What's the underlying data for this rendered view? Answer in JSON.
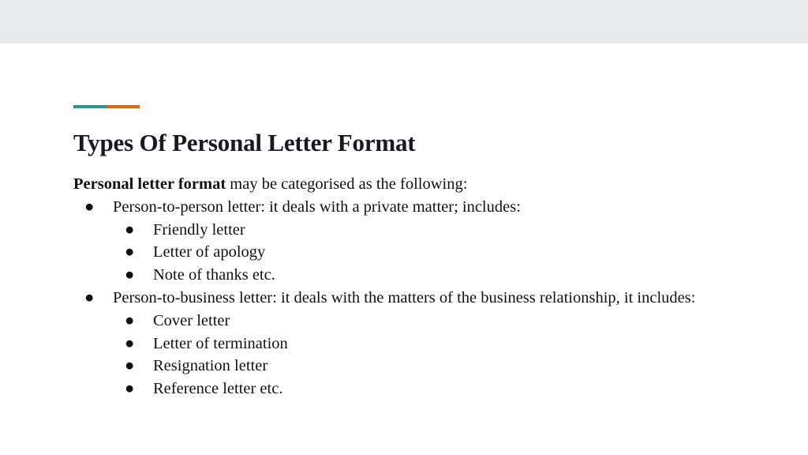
{
  "slide": {
    "title": "Types Of Personal Letter Format",
    "accent_colors": [
      "#26998a",
      "#e8600f"
    ],
    "intro_bold": "Personal letter format",
    "intro_rest": " may be categorised as the following:",
    "bullet_glyph": "●",
    "items": [
      {
        "text": "Person-to-person letter: it deals with a private matter; includes:",
        "subitems": [
          "Friendly letter",
          "Letter of apology",
          "Note of thanks etc."
        ]
      },
      {
        "text": "Person-to-business letter: it deals with the matters of the business relationship, it includes:",
        "subitems": [
          "Cover letter",
          "Letter of termination",
          "Resignation letter",
          "Reference letter etc."
        ]
      }
    ]
  }
}
